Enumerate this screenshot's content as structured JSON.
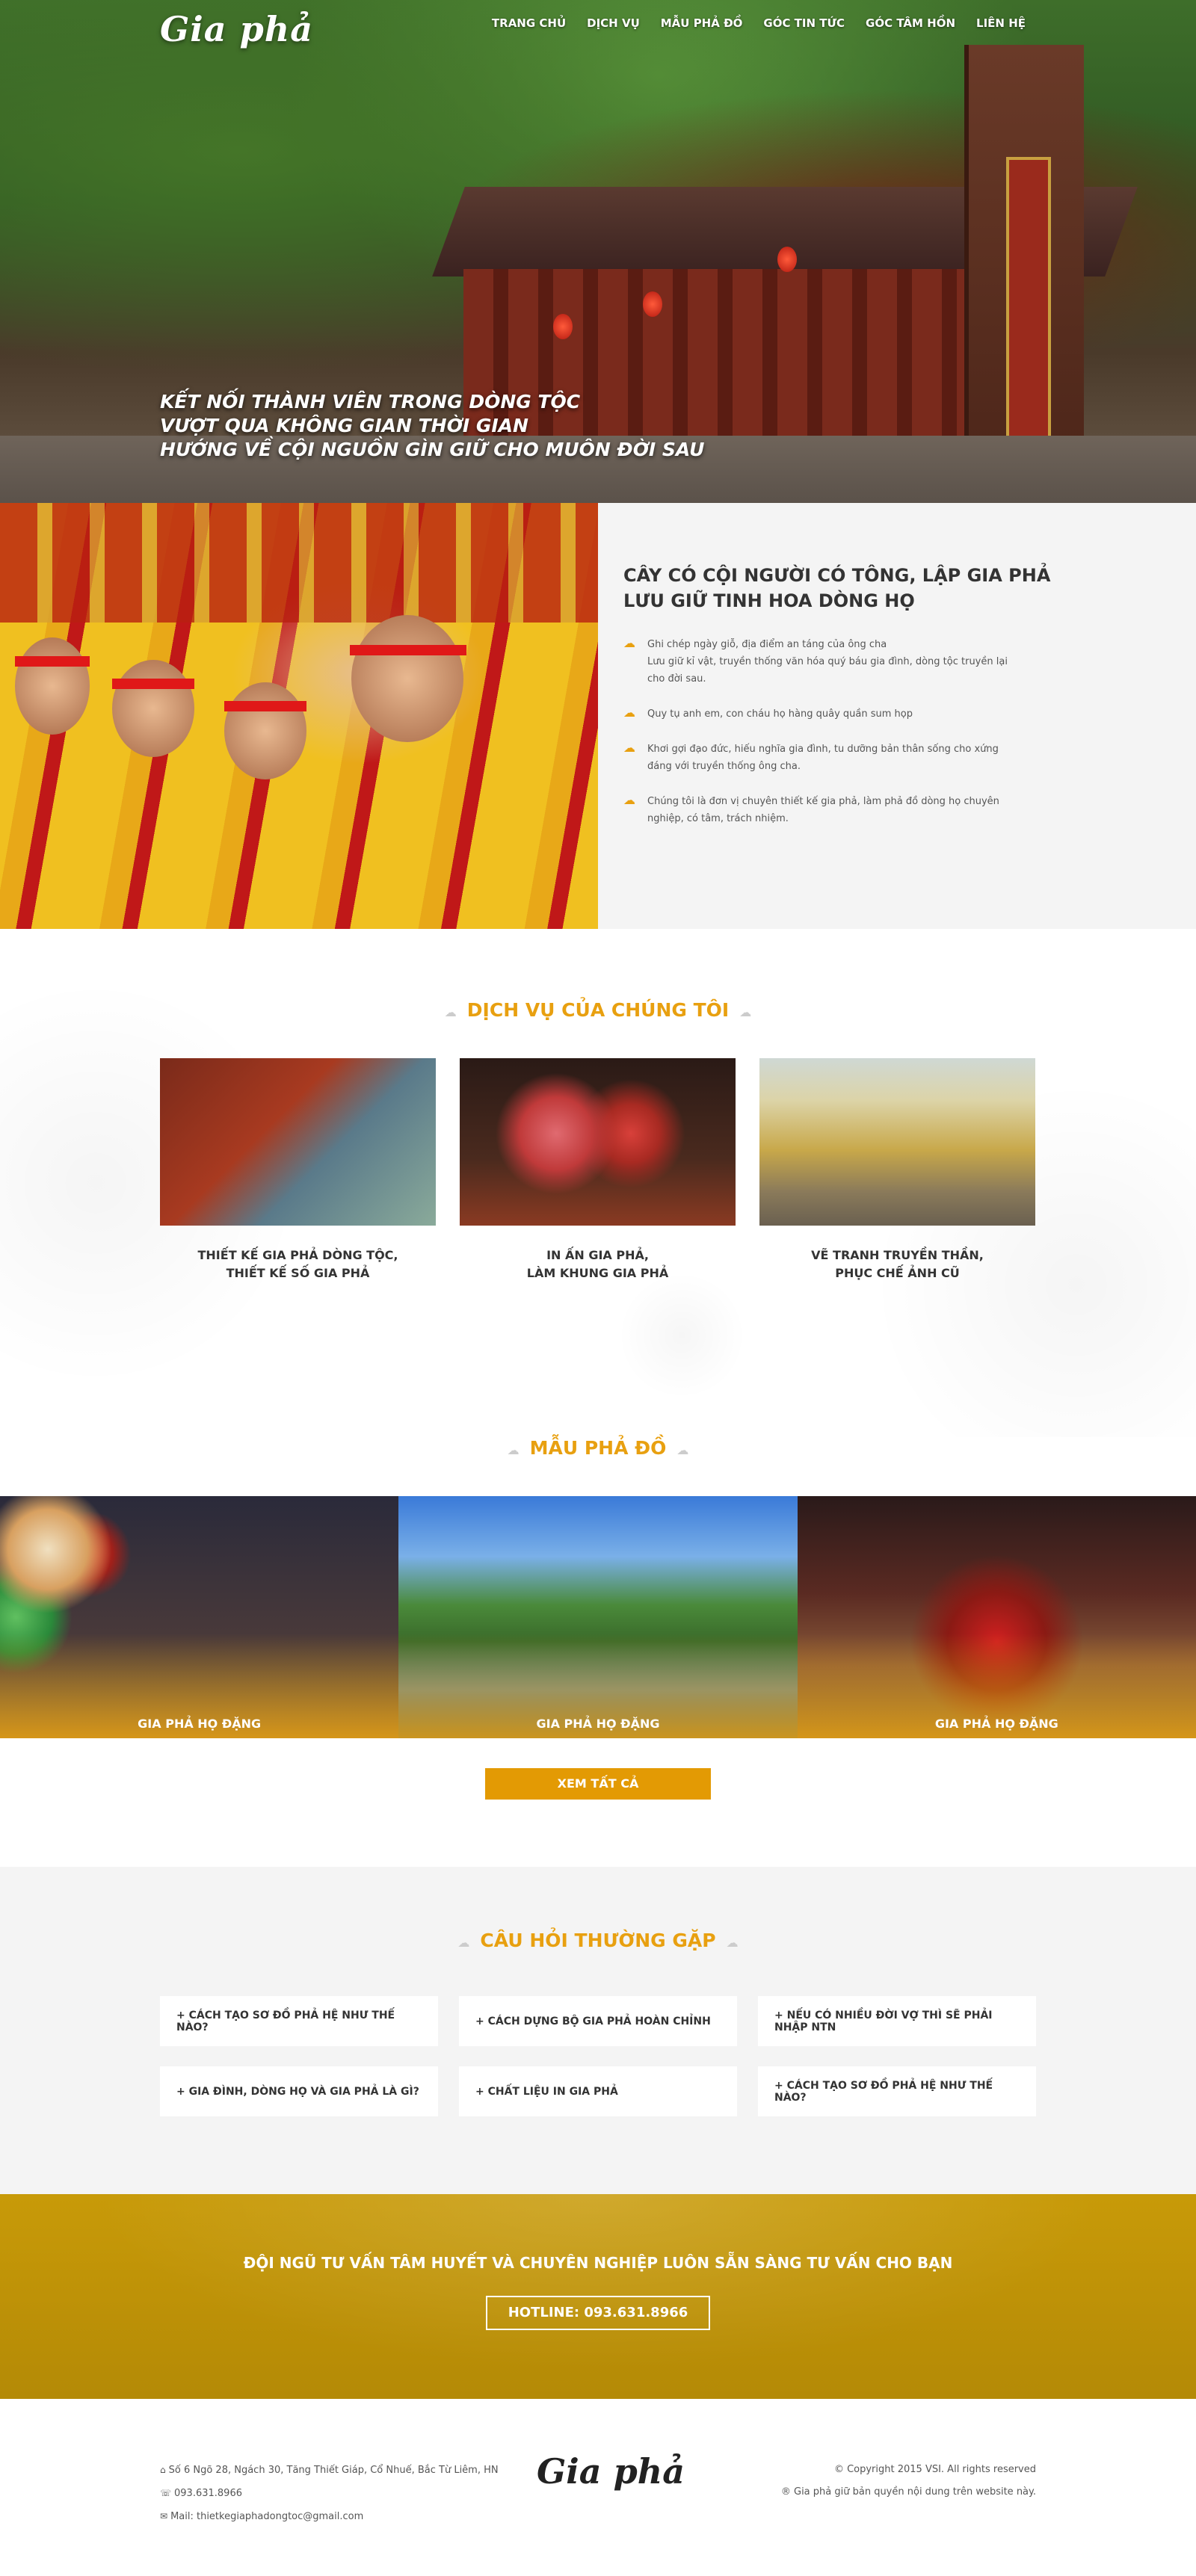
{
  "header": {
    "logo": "Gia phả",
    "nav": [
      "TRANG CHỦ",
      "DỊCH VỤ",
      "MẪU PHẢ ĐỒ",
      "GÓC TIN TỨC",
      "GÓC TÂM HỒN",
      "LIÊN HỆ"
    ]
  },
  "hero": {
    "lines": [
      "KẾT NỐI THÀNH VIÊN TRONG DÒNG TỘC",
      "VƯỢT QUA KHÔNG GIAN THỜI GIAN",
      "HƯỚNG VỀ CỘI NGUỒN GÌN GIỮ CHO MUÔN ĐỜI SAU"
    ]
  },
  "about": {
    "title_line1": "CÂY CÓ CỘI NGƯỜI CÓ TÔNG, LẬP GIA PHẢ",
    "title_line2": "LƯU GIỮ TINH HOA DÒNG HỌ",
    "items": [
      "Ghi chép ngày giỗ, địa điểm an táng của ông cha\nLưu giữ kỉ vật, truyền thống văn hóa quý báu gia đình, dòng tộc truyền lại cho đời sau.",
      "Quy tụ anh em, con cháu họ hàng quây quần sum họp",
      "Khơi gợi đạo đức, hiếu nghĩa gia đình, tu dưỡng bản thân sống cho xứng đáng với truyền thống ông cha.",
      "Chúng tôi là đơn vị chuyên thiết kế gia phả, làm phả đồ dòng họ chuyên nghiệp, có tâm, trách nhiệm."
    ]
  },
  "services": {
    "title": "DỊCH VỤ CỦA CHÚNG TÔI",
    "items": [
      {
        "line1": "THIẾT KẾ GIA PHẢ DÒNG TỘC,",
        "line2": "THIẾT KẾ SỐ GIA PHẢ"
      },
      {
        "line1": "IN ẤN GIA PHẢ,",
        "line2": "LÀM KHUNG GIA PHẢ"
      },
      {
        "line1": "VẼ TRANH TRUYỀN THẦN,",
        "line2": "PHỤC CHẾ ẢNH CŨ"
      }
    ]
  },
  "samples": {
    "title": "MẪU PHẢ ĐỒ",
    "items": [
      "GIA PHẢ HỌ ĐẶNG",
      "GIA PHẢ HỌ ĐẶNG",
      "GIA PHẢ HỌ ĐẶNG"
    ],
    "button": "XEM TẤT CẢ"
  },
  "faq": {
    "title": "CÂU HỎI THƯỜNG GẶP",
    "items": [
      "+ CÁCH TẠO SƠ ĐỒ PHẢ HỆ NHƯ THẾ NÀO?",
      "+ CÁCH DỰNG BỘ GIA PHẢ HOÀN CHỈNH",
      "+ NẾU CÓ NHIỀU ĐỜI VỢ THÌ SẼ PHẢI NHẬP NTN",
      "+ GIA ĐÌNH, DÒNG HỌ VÀ GIA PHẢ LÀ GÌ?",
      "+ CHẤT LIỆU IN GIA PHẢ",
      "+ CÁCH TẠO SƠ ĐỒ PHẢ HỆ NHƯ THẾ NÀO?"
    ]
  },
  "cta": {
    "title": "ĐỘI NGŨ TƯ VẤN TÂM HUYẾT VÀ CHUYÊN NGHIỆP LUÔN SẴN SÀNG TƯ VẤN CHO BẠN",
    "hotline": "HOTLINE: 093.631.8966"
  },
  "footer": {
    "address": "Số 6 Ngõ 28, Ngách 30, Tăng Thiết Giáp, Cổ Nhuế, Bắc Từ Liêm, HN",
    "phone": "093.631.8966",
    "mail": "Mail: thietkegiaphadongtoc@gmail.com",
    "logo": "Gia phả",
    "copyright": "© Copyright 2015 VSI. All rights reserved",
    "rights": "® Gia phả giữ bản quyền nội dung trên website này."
  }
}
